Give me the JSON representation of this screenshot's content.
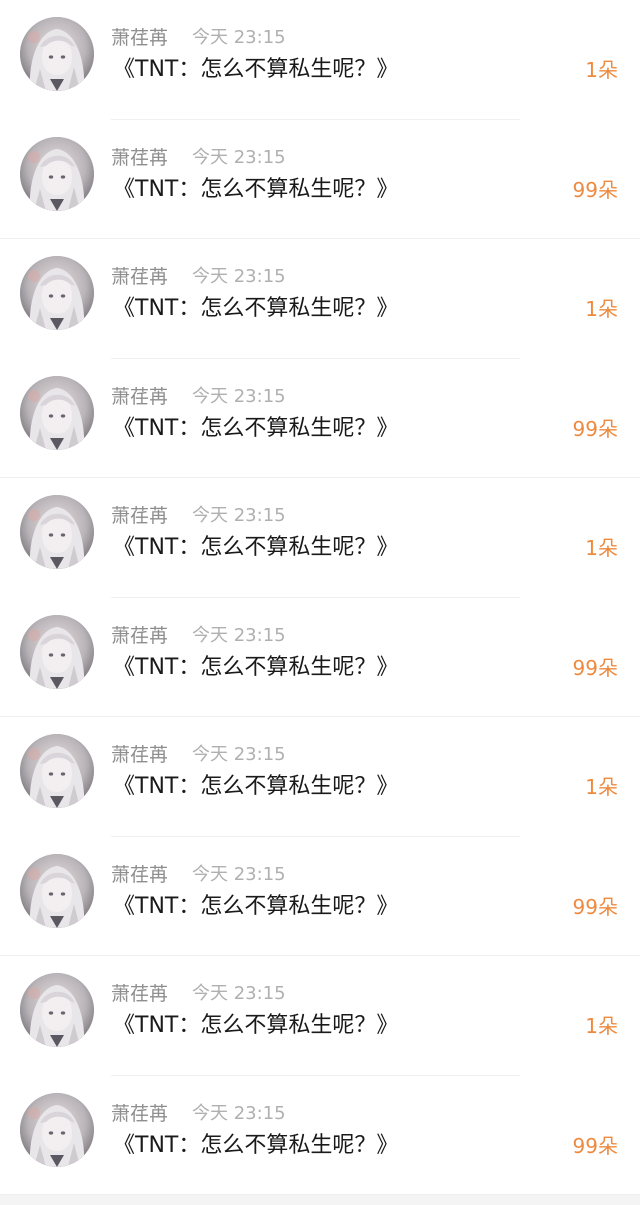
{
  "colors": {
    "accent": "#ee8a3f",
    "name_text": "#8e8e8e",
    "time_text": "#b0b0b0",
    "message_text": "#1a1a1a"
  },
  "gift_records": [
    {
      "avatar_icon": "anime-avatar-icon",
      "user_name": "萧荏苒",
      "timestamp": "今天 23:15",
      "message": "《TNT：怎么不算私生呢？》",
      "count": "1朵"
    },
    {
      "avatar_icon": "anime-avatar-icon",
      "user_name": "萧荏苒",
      "timestamp": "今天 23:15",
      "message": "《TNT：怎么不算私生呢？》",
      "count": "99朵"
    },
    {
      "avatar_icon": "anime-avatar-icon",
      "user_name": "萧荏苒",
      "timestamp": "今天 23:15",
      "message": "《TNT：怎么不算私生呢？》",
      "count": "1朵"
    },
    {
      "avatar_icon": "anime-avatar-icon",
      "user_name": "萧荏苒",
      "timestamp": "今天 23:15",
      "message": "《TNT：怎么不算私生呢？》",
      "count": "99朵"
    },
    {
      "avatar_icon": "anime-avatar-icon",
      "user_name": "萧荏苒",
      "timestamp": "今天 23:15",
      "message": "《TNT：怎么不算私生呢？》",
      "count": "1朵"
    },
    {
      "avatar_icon": "anime-avatar-icon",
      "user_name": "萧荏苒",
      "timestamp": "今天 23:15",
      "message": "《TNT：怎么不算私生呢？》",
      "count": "99朵"
    },
    {
      "avatar_icon": "anime-avatar-icon",
      "user_name": "萧荏苒",
      "timestamp": "今天 23:15",
      "message": "《TNT：怎么不算私生呢？》",
      "count": "1朵"
    },
    {
      "avatar_icon": "anime-avatar-icon",
      "user_name": "萧荏苒",
      "timestamp": "今天 23:15",
      "message": "《TNT：怎么不算私生呢？》",
      "count": "99朵"
    },
    {
      "avatar_icon": "anime-avatar-icon",
      "user_name": "萧荏苒",
      "timestamp": "今天 23:15",
      "message": "《TNT：怎么不算私生呢？》",
      "count": "1朵"
    },
    {
      "avatar_icon": "anime-avatar-icon",
      "user_name": "萧荏苒",
      "timestamp": "今天 23:15",
      "message": "《TNT：怎么不算私生呢？》",
      "count": "99朵"
    }
  ]
}
